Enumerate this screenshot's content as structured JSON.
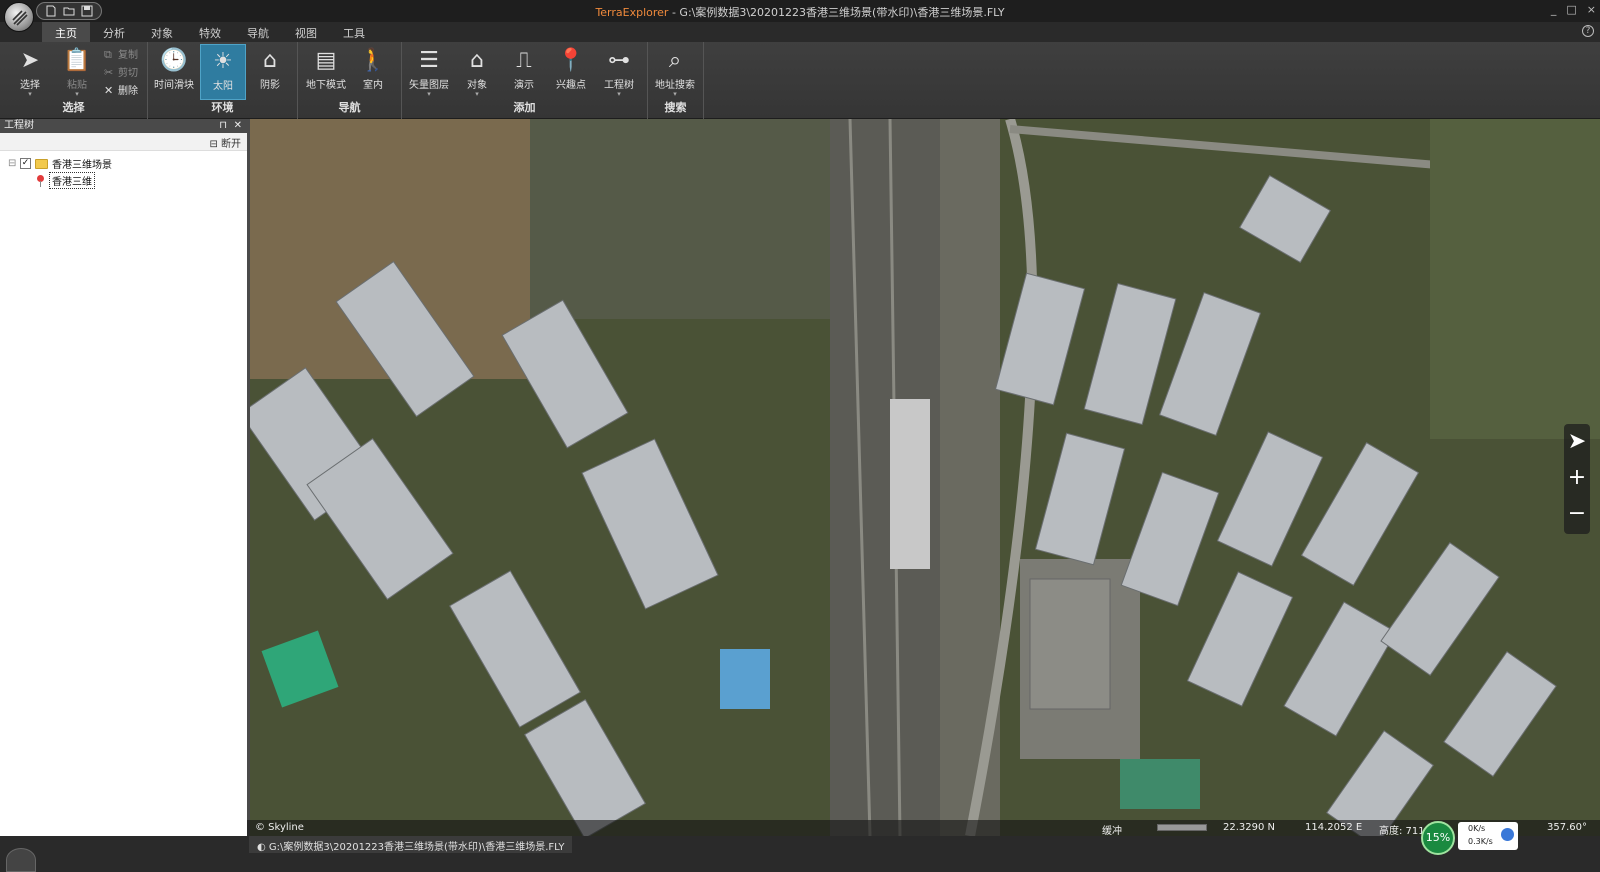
{
  "window": {
    "app_name": "TerraExplorer",
    "file_path": " - G:\\案例数据3\\20201223香港三维场景(带水印)\\香港三维场景.FLY",
    "controls": [
      "_",
      "□",
      "×"
    ]
  },
  "menu": {
    "tabs": [
      "主页",
      "分析",
      "对象",
      "特效",
      "导航",
      "视图",
      "工具"
    ],
    "active": "主页"
  },
  "ribbon": {
    "select_group": {
      "label": "选择",
      "select": "选择",
      "paste": "粘贴",
      "copy": "复制",
      "cut": "剪切",
      "delete": "删除"
    },
    "env_group": {
      "label": "环境",
      "time_slider": "时间滑块",
      "sun": "太阳",
      "shadow": "阴影"
    },
    "nav_group": {
      "label": "导航",
      "underground": "地下模式",
      "indoor": "室内"
    },
    "add_group": {
      "label": "添加",
      "vector_layer": "矢量图层",
      "object": "对象",
      "presentation": "演示",
      "poi": "兴趣点",
      "project_tree": "工程树"
    },
    "search_group": {
      "label": "搜索",
      "address_search": "地址搜索"
    }
  },
  "project_tree": {
    "title": "工程树",
    "disconnect": "断开",
    "items": [
      {
        "label": "香港三维场景",
        "checked": true,
        "type": "folder"
      },
      {
        "label": "香港三维",
        "type": "location"
      }
    ]
  },
  "viewport": {
    "watermark": "© Skyline",
    "buffer_label": "缓冲",
    "lat": "22.3290 N",
    "lon": "114.2052 E",
    "altitude": "高度: 711.44",
    "heading": "357.60°"
  },
  "network": {
    "percent": "15%",
    "upload": "0K/s",
    "download": "0.3K/s"
  },
  "bottom_tab": {
    "label": "G:\\案例数据3\\20201223香港三维场景(带水印)\\香港三维场景.FLY"
  },
  "colors": {
    "accent": "#f08a3c",
    "active_button": "#2f7ca0",
    "network_ok": "#1a8a40"
  }
}
